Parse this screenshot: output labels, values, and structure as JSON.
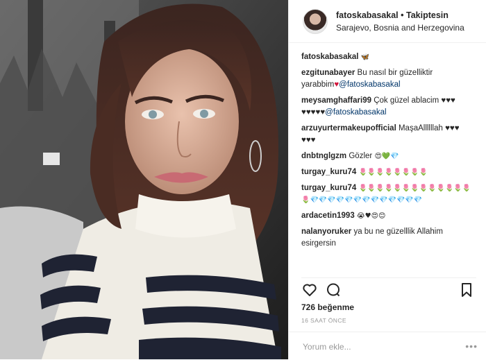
{
  "post": {
    "username": "fatoskabasakal",
    "separator": "•",
    "follow_label": "Takiptesin",
    "location": "Sarajevo, Bosnia and Herzegovina"
  },
  "caption": {
    "user": "fatoskabasakal",
    "text": "🦋"
  },
  "comments": [
    {
      "user": "ezgitunabayer",
      "text": "Bu nasıl bir güzelliktir yarabbim",
      "emoji": "♥",
      "mention": "@fatoskabasakal"
    },
    {
      "user": "meysamghaffari99",
      "text": "Çok güzel ablacim",
      "emoji": "♥♥♥ ♥♥♥♥♥",
      "mention": "@fatoskabasakal"
    },
    {
      "user": "arzuyurtermakeupofficial",
      "text": "MaşaAllllllah",
      "emoji": "♥♥♥ ♥♥♥"
    },
    {
      "user": "dnbtnglgzm",
      "text": "Gözler",
      "emoji": "😍💚💎"
    },
    {
      "user": "turgay_kuru74",
      "text": "",
      "emoji": "🌷🌷🌷🌷🌷🌷🌷🌷"
    },
    {
      "user": "turgay_kuru74",
      "text": "",
      "emoji": "🌷🌷🌷🌷🌷🌷🌷🌷🌷🌷🌷🌷🌷🌷💎💎💎💎💎💎💎💎💎💎💎💎💎"
    },
    {
      "user": "ardacetin1993",
      "text": "",
      "emoji": "😭♥😍😊"
    },
    {
      "user": "nalanyoruker",
      "text": "ya bu ne güzelllik Allahim esirgersin",
      "emoji": ""
    }
  ],
  "likes_text": "726 beğenme",
  "time_text": "16 SAAT ÖNCE",
  "comment_input": {
    "placeholder": "Yorum ekle..."
  },
  "more_label": "•••",
  "icons": {
    "like": "heart-outline-icon",
    "comment": "comment-bubble-icon",
    "save": "bookmark-icon"
  },
  "colors": {
    "link": "#003569",
    "heart": "#d2143a",
    "muted": "#999999",
    "text": "#262626"
  }
}
